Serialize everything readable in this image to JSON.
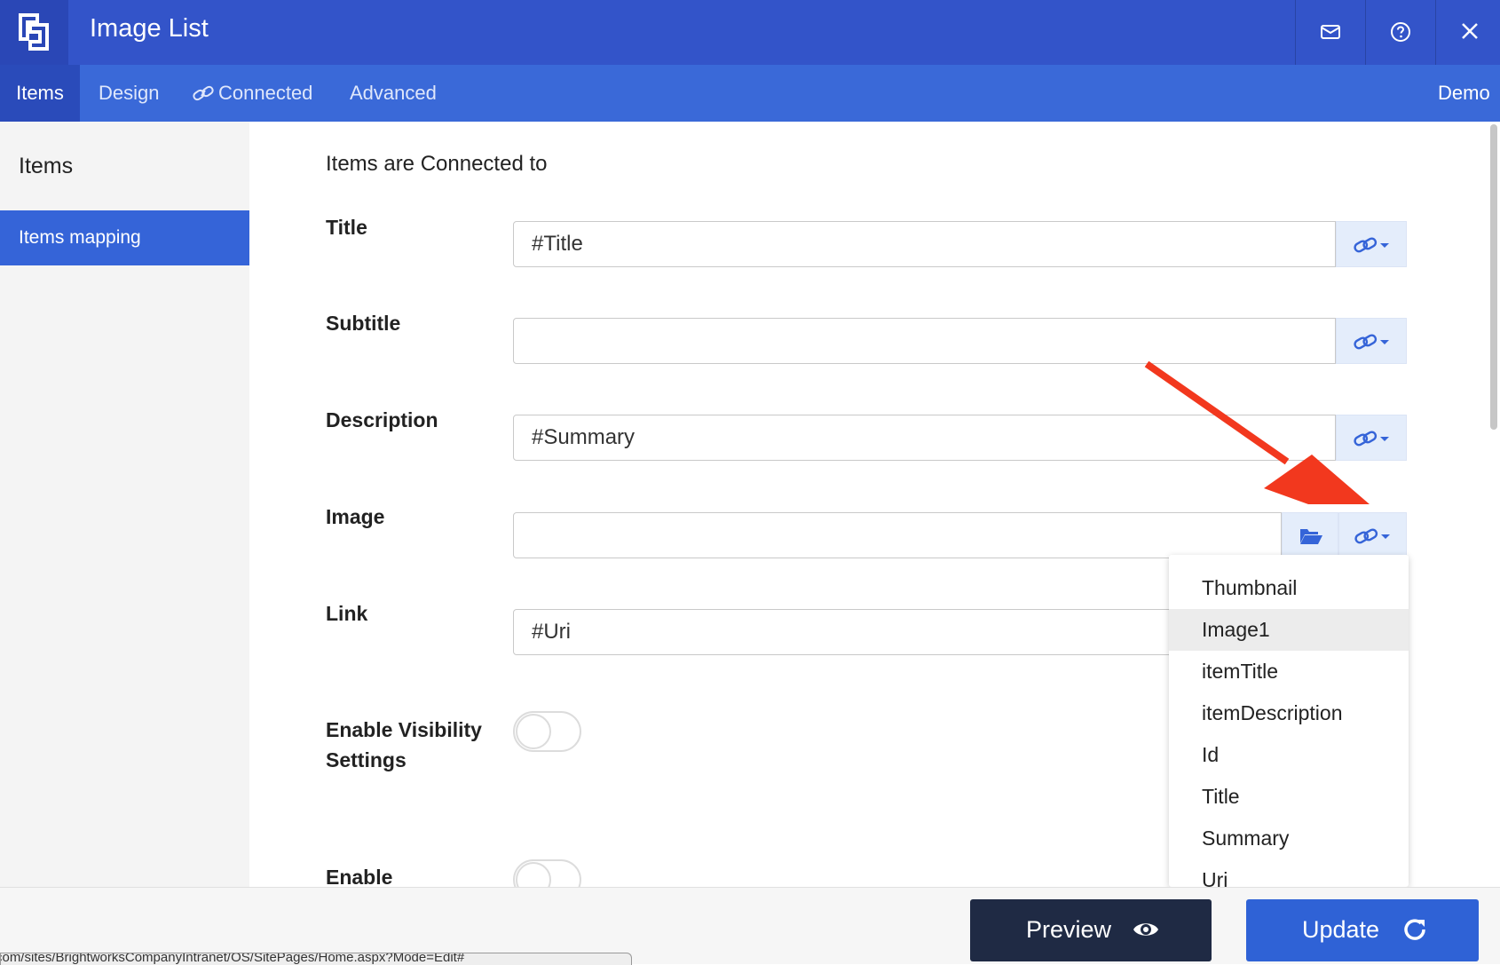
{
  "window": {
    "title": "Image List",
    "icons": [
      "logo-icon",
      "mail-icon",
      "help-icon",
      "close-icon"
    ]
  },
  "tabs": [
    {
      "label": "Items",
      "active": true
    },
    {
      "label": "Design",
      "active": false
    },
    {
      "label": "Connected",
      "active": false,
      "icon": "link-icon"
    },
    {
      "label": "Advanced",
      "active": false
    }
  ],
  "tab_right_label": "Demo",
  "sidebar": {
    "heading": "Items",
    "items": [
      {
        "label": "Items mapping",
        "active": true
      }
    ]
  },
  "main": {
    "heading": "Items are Connected to",
    "fields": [
      {
        "label": "Title",
        "value": "#Title"
      },
      {
        "label": "Subtitle",
        "value": ""
      },
      {
        "label": "Description",
        "value": "#Summary"
      },
      {
        "label": "Image",
        "value": ""
      },
      {
        "label": "Link",
        "value": "#Uri"
      }
    ],
    "toggles": [
      {
        "label": "Enable Visibility Settings",
        "on": false
      },
      {
        "label": "Enable",
        "on": false
      }
    ]
  },
  "dropdown": {
    "items": [
      "Thumbnail",
      "Image1",
      "itemTitle",
      "itemDescription",
      "Id",
      "Title",
      "Summary",
      "Uri"
    ],
    "highlighted": "Image1"
  },
  "footer": {
    "preview_label": "Preview",
    "update_label": "Update"
  },
  "status_url": "com/sites/BrightworksCompanyIntranet/OS/SitePages/Home.aspx?Mode=Edit#",
  "colors": {
    "titlebar": "#3354c9",
    "tabbar": "#3a69d8",
    "accent": "#2f62d6",
    "preview_button": "#1f2a44",
    "annotation_arrow": "#f2381e"
  }
}
